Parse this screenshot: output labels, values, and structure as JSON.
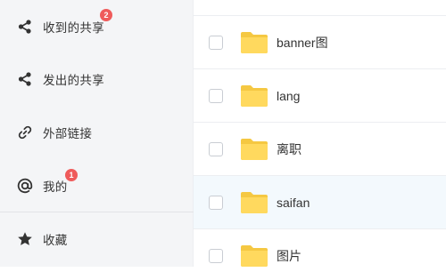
{
  "sidebar": {
    "items": [
      {
        "label": "收到的共享",
        "icon": "share-icon",
        "badge": "2"
      },
      {
        "label": "发出的共享",
        "icon": "share-icon"
      },
      {
        "label": "外部链接",
        "icon": "link-icon"
      },
      {
        "label": "我的",
        "icon": "at-icon",
        "badge": "1"
      },
      {
        "label": "收藏",
        "icon": "star-icon"
      }
    ]
  },
  "files": {
    "rows": [
      {
        "name": "banner图",
        "type": "folder"
      },
      {
        "name": "lang",
        "type": "folder"
      },
      {
        "name": "离职",
        "type": "folder"
      },
      {
        "name": "saifan",
        "type": "folder"
      },
      {
        "name": "图片",
        "type": "folder"
      }
    ]
  },
  "colors": {
    "sidebar_bg": "#f4f5f7",
    "badge": "#ef5b5b",
    "folder": "#fcd45d",
    "row_hover": "#f3f9fd"
  }
}
